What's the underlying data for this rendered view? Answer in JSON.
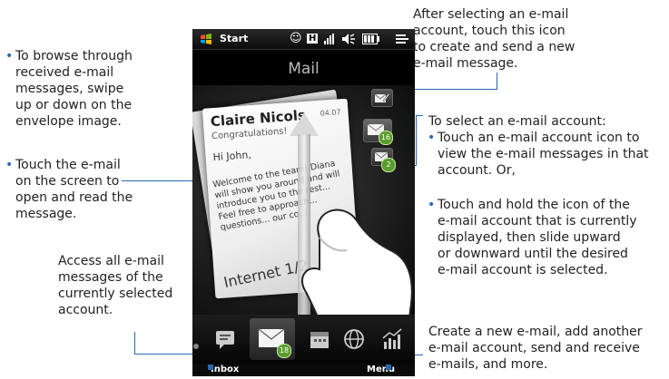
{
  "left_callouts": {
    "browse": [
      "To browse through",
      "received e-mail",
      "messages, swipe",
      "up or down on the",
      "envelope image."
    ],
    "touch_open": [
      "Touch the e-mail",
      "on the screen to",
      "open and read the",
      "message."
    ],
    "access_all": [
      "Access all e-mail",
      "messages of the",
      "currently selected",
      "account."
    ]
  },
  "right_callouts": {
    "compose": [
      "After selecting an e-mail",
      "account, touch this icon",
      "to create and send a new",
      "e-mail message."
    ],
    "select_title": "To select an e-mail account:",
    "select_b1": [
      "Touch an e-mail account icon to",
      "view the e-mail messages in that",
      "account. Or,"
    ],
    "select_b2": [
      "Touch and hold the icon of the",
      "e-mail account that is currently",
      "displayed, then slide upward",
      "or downward until the desired",
      "e-mail account is selected."
    ],
    "menu": [
      "Create a new e-mail, add another",
      "e-mail account, send and receive",
      "e-mails, and more."
    ]
  },
  "phone": {
    "status": {
      "start_label": "Start"
    },
    "title": "Mail",
    "envelope": {
      "sender": "Claire Nicols",
      "date": "04.07",
      "subject": "Congratulations!",
      "greeting": "Hi John,",
      "body": "Welcome to the team! Diana will show you around and will introduce you to the rest... Feel free to approach... questions... our co...",
      "footer": "Internet 1/2"
    },
    "accounts": [
      {
        "name": "compose-icon",
        "badge": ""
      },
      {
        "name": "account-1",
        "badge": "16"
      },
      {
        "name": "account-2",
        "badge": "2"
      }
    ],
    "tab_badge": "18",
    "softkeys": {
      "left": "Inbox",
      "right": "Menu"
    }
  },
  "colors": {
    "accent": "#2a66b0",
    "badge": "#5a9d2c"
  }
}
